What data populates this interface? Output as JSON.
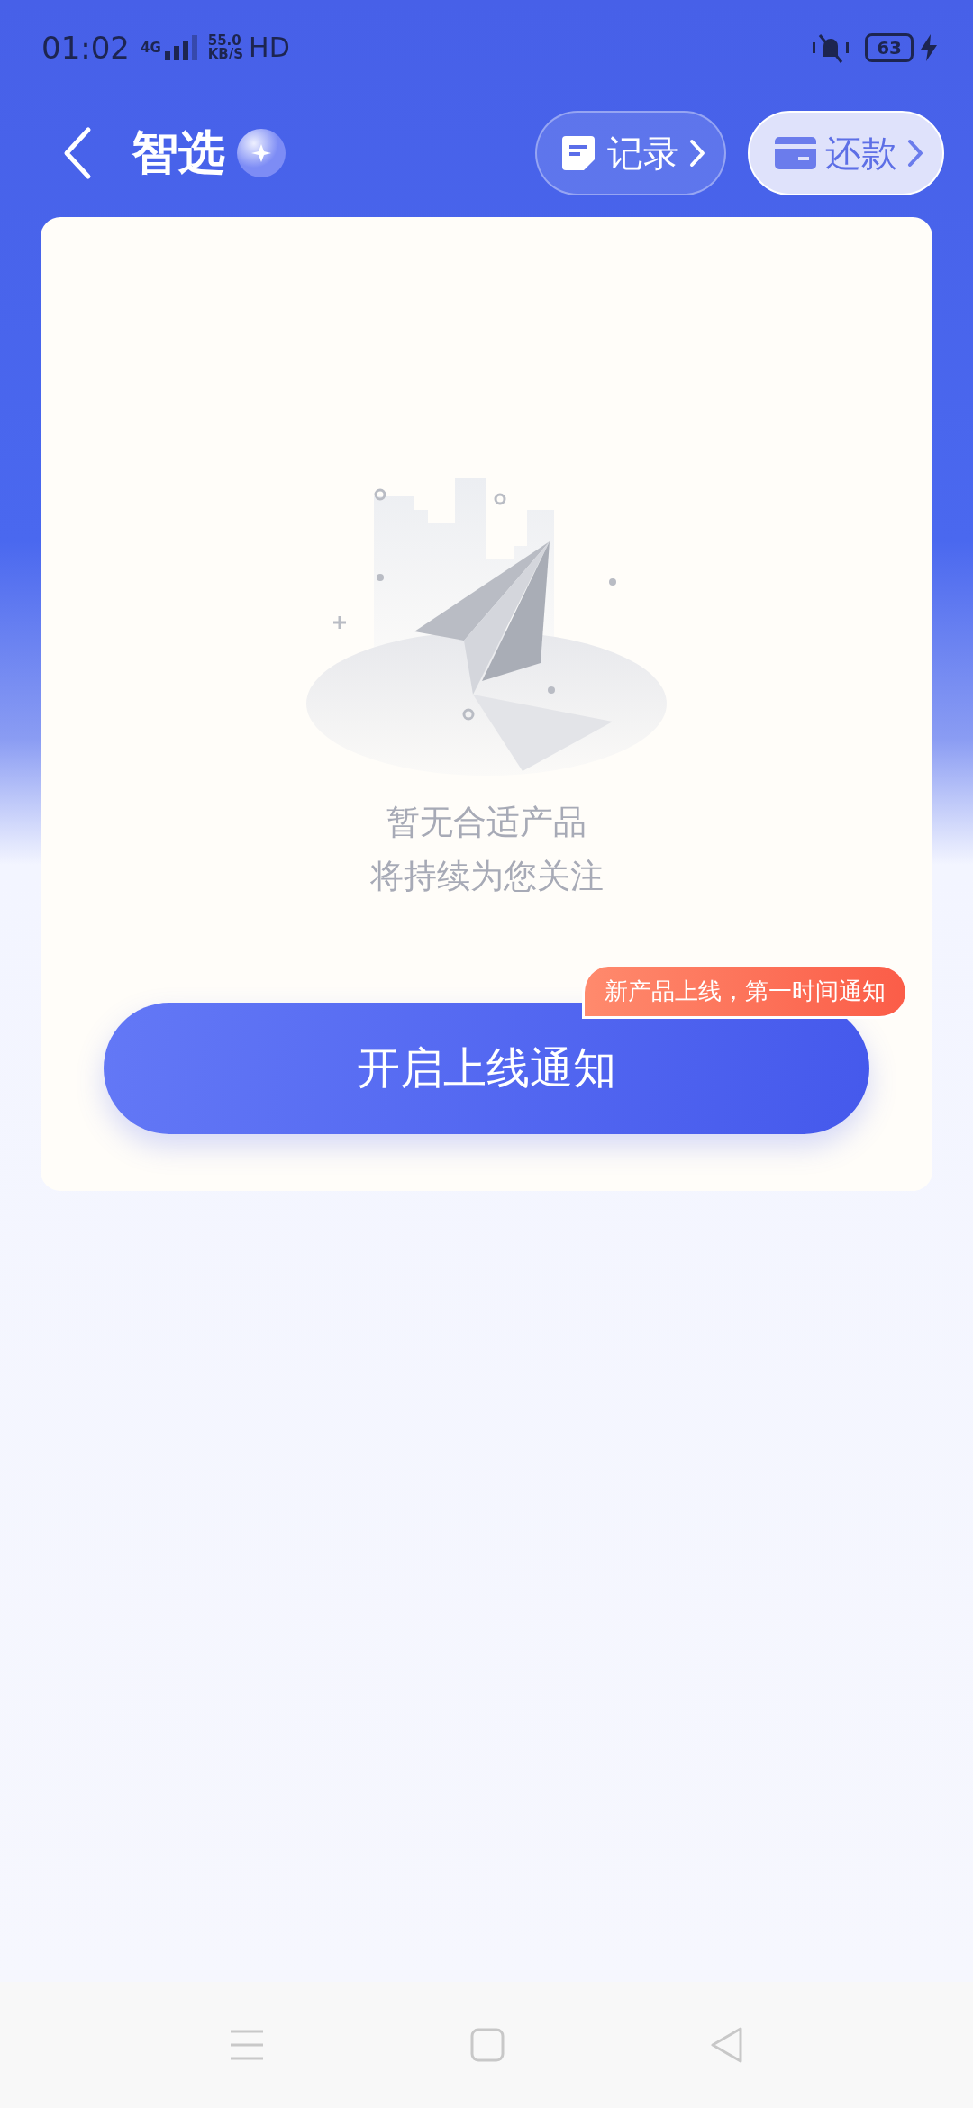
{
  "status_bar": {
    "time": "01:02",
    "network": "4G",
    "speed_value": "55.0",
    "speed_unit": "KB/S",
    "hd": "HD",
    "battery": "63"
  },
  "header": {
    "title": "智选",
    "actions": [
      {
        "label": "记录",
        "kind": "record"
      },
      {
        "label": "还款",
        "kind": "repay"
      }
    ]
  },
  "empty_state": {
    "lines": [
      "暂无合适产品",
      "将持续为您关注"
    ]
  },
  "notify_button": {
    "label": "开启上线通知",
    "badge": "新产品上线，第一时间通知"
  }
}
